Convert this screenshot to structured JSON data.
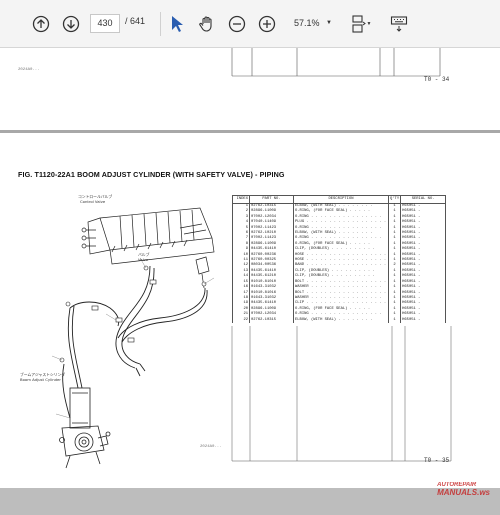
{
  "toolbar": {
    "page_current": "430",
    "page_total": "/ 641",
    "zoom": "57.1%"
  },
  "prev_page": {
    "stamp": "2024A0...",
    "page_number": "T0 - 34"
  },
  "page": {
    "figure_title": "FIG. T1120-22A1    BOOM ADJUST CYLINDER (WITH SAFETY VALVE) - PIPING",
    "page_number": "T0 - 35",
    "drawing_labels": {
      "top_jp": "コントロールバルブ",
      "top_en": "Control Valve",
      "side_jp": "バルブ",
      "side_en": "Valve",
      "bottom_jp": "ブームアジャストシリンダ",
      "bottom_en": "Boom Adjust Cylinder"
    },
    "stamp": "2024A0..."
  },
  "parts_table": {
    "headers": [
      "INDEX",
      "PART NO.",
      "DESCRIPTION",
      "Q'TY",
      "SERIAL NO."
    ],
    "rows": [
      [
        "1",
        "02762-10315",
        "ELBOW, (WITH SEAL) . . . . . . . .",
        "1",
        "H65051 -"
      ],
      [
        "2",
        "02896-11009",
        "O-RING, (FOR FACE SEAL) . . . . .",
        "1",
        "H65051 -"
      ],
      [
        "3",
        "07002-12034",
        "O-RING . . . . . . . . . . . . . . . .",
        "1",
        "H65051 -"
      ],
      [
        "4",
        "07040-11409",
        "PLUG . . . . . . . . . . . . . . . . . .",
        "1",
        "H65051 -"
      ],
      [
        "5",
        "07002-11423",
        "O-RING . . . . . . . . . . . . . . . .",
        "1",
        "H65051 -"
      ],
      [
        "6",
        "02762-10210",
        "ELBOW, (WITH SEAL) . . . . . . . .",
        "1",
        "H65051 -"
      ],
      [
        "7",
        "07002-11423",
        "O-RING . . . . . . . . . . . . . . . .",
        "1",
        "H65051 -"
      ],
      [
        "8",
        "02896-11009",
        "O-RING, (FOR FACE SEAL) . . . . .",
        "1",
        "H65051 -"
      ],
      [
        "9",
        "04435-61410",
        "CLIP, (DOUBLES) . . . . . . . . . .",
        "1",
        "H65051 -"
      ],
      [
        "10",
        "02760-00236",
        "HOSE . . . . . . . . . . . . . . . . . .",
        "1",
        "H65051 -"
      ],
      [
        "11",
        "02760-00325",
        "HOSE . . . . . . . . . . . . . . . . . .",
        "1",
        "H65051 -"
      ],
      [
        "12",
        "08034-00536",
        "BAND . . . . . . . . . . . . . . . . . .",
        "2",
        "H65051 -"
      ],
      [
        "13",
        "04435-61410",
        "CLIP, (DOUBLES) . . . . . . . . . .",
        "1",
        "H65051 -"
      ],
      [
        "14",
        "04435-61210",
        "CLIP, (DOUBLES) . . . . . . . . . .",
        "1",
        "H65051 -"
      ],
      [
        "15",
        "01010-81010",
        "BOLT . . . . . . . . . . . . . . . . . .",
        "1",
        "H65051 -"
      ],
      [
        "16",
        "01643-31032",
        "WASHER . . . . . . . . . . . . . . . .",
        "1",
        "H65051 -"
      ],
      [
        "17",
        "01010-81016",
        "BOLT . . . . . . . . . . . . . . . . . .",
        "1",
        "H65051 -"
      ],
      [
        "18",
        "01643-31032",
        "WASHER . . . . . . . . . . . . . . . .",
        "1",
        "H65051 -"
      ],
      [
        "19",
        "04435-61410",
        "CLIP . . . . . . . . . . . . . . . . . .",
        "1",
        "H65051 -"
      ],
      [
        "20",
        "02896-11009",
        "O-RING, (FOR FACE SEAL) . . . . .",
        "1",
        "H65051 -"
      ],
      [
        "21",
        "07002-12034",
        "O-RING . . . . . . . . . . . . . . . .",
        "1",
        "H65051 -"
      ],
      [
        "22",
        "02762-10315",
        "ELBOW, (WITH SEAL) . . . . . . . .",
        "1",
        "H65051 -"
      ]
    ]
  },
  "watermark": {
    "line1": "AUTOREPAIR",
    "line2": "MANUALS.ws"
  },
  "colors": {
    "toolbar_bg": "#f4f4f4",
    "viewer_bg": "#bdbdbd",
    "cursor_blue": "#2a5db0"
  }
}
